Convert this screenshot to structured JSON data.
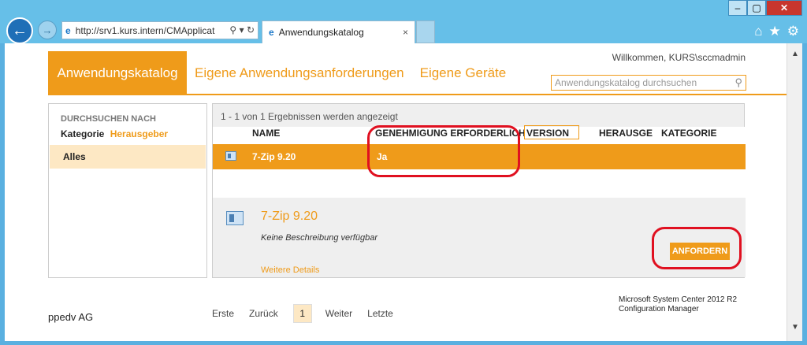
{
  "browser": {
    "address": "http://srv1.kurs.intern/CMApplicat",
    "address_host_bold": "kurs.intern",
    "tab_title": "Anwendungskatalog",
    "close_tab": "×",
    "window_controls": [
      "–",
      "▢",
      "✕"
    ],
    "nav_icons": [
      "home-icon",
      "star-icon",
      "gear-icon"
    ]
  },
  "header": {
    "welcome": "Willkommen, KURS\\sccmadmin",
    "nav": [
      "Anwendungskatalog",
      "Eigene Anwendungsanforderungen",
      "Eigene Geräte"
    ],
    "search_placeholder": "Anwendungskatalog durchsuchen"
  },
  "sidebar": {
    "header": "DURCHSUCHEN NACH",
    "tab_category": "Kategorie",
    "tab_publisher": "Herausgeber",
    "selected_item": "Alles"
  },
  "results": {
    "count_text": "1 - 1 von 1 Ergebnissen werden angezeigt",
    "columns": [
      "NAME",
      "GENEHMIGUNG ERFORDERLICH",
      "VERSION",
      "HERAUSGE",
      "KATEGORIE"
    ],
    "rows": [
      {
        "name": "7-Zip 9.20",
        "approval": "Ja",
        "version": "",
        "publisher": "",
        "category": ""
      }
    ]
  },
  "detail": {
    "title": "7-Zip 9.20",
    "description": "Keine Beschreibung verfügbar",
    "more_link": "Weitere Details",
    "request_button": "ANFORDERN"
  },
  "footer": {
    "org": "ppedv AG",
    "pager": {
      "first": "Erste",
      "back": "Zurück",
      "current": "1",
      "next": "Weiter",
      "last": "Letzte"
    },
    "product_line1": "Microsoft System Center 2012 R2",
    "product_line2": "Configuration Manager"
  },
  "colors": {
    "accent": "#ef9b1a",
    "highlight": "#fde8c4",
    "annotation": "#e01020"
  }
}
